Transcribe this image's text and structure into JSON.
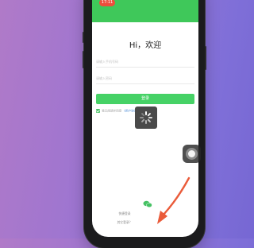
{
  "status_bar": {
    "time": "17:11"
  },
  "login": {
    "title": "Hi，欢迎",
    "phone_placeholder": "请输入手机号码",
    "password_placeholder": "请输入密码",
    "login_button": "登录",
    "agreement_prefix": "我已阅读并同意",
    "agreement_link": "《用户协议》《隐私政策》"
  },
  "footer": {
    "quick_login": "快捷登录",
    "other_login": "其它登录？"
  },
  "overlay": {
    "loading_icon": "spinner-icon",
    "assistive_touch": "assistive-touch-icon"
  },
  "colors": {
    "accent_green": "#46d266",
    "arrow": "#ea5b3a",
    "link_blue": "#4b8bd6"
  }
}
